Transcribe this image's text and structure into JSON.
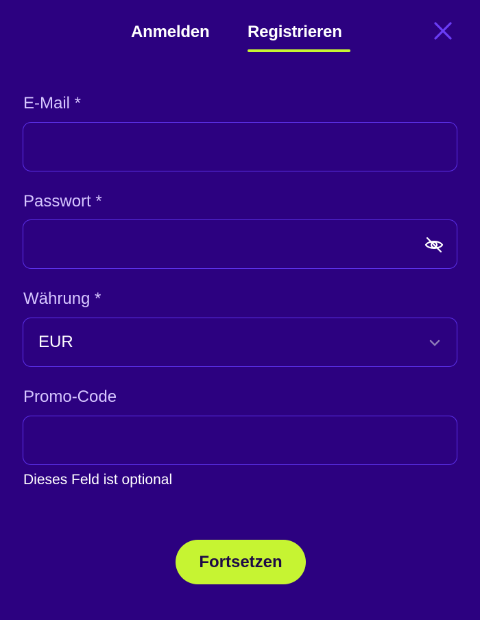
{
  "tabs": {
    "login_label": "Anmelden",
    "register_label": "Registrieren",
    "active": "register"
  },
  "icons": {
    "close": "close-icon",
    "password_toggle": "eye-off-icon",
    "select_arrow": "chevron-down-icon"
  },
  "form": {
    "email": {
      "label": "E-Mail *",
      "value": ""
    },
    "password": {
      "label": "Passwort *",
      "value": ""
    },
    "currency": {
      "label": "Währung *",
      "selected": "EUR"
    },
    "promo": {
      "label": "Promo-Code",
      "value": "",
      "helper": "Dieses Feld ist optional"
    },
    "submit_label": "Fortsetzen"
  },
  "colors": {
    "background": "#2c0180",
    "accent": "#c6f432",
    "border": "#5b30e8",
    "label": "#d6c6ff",
    "close_icon": "#6a3df5"
  }
}
